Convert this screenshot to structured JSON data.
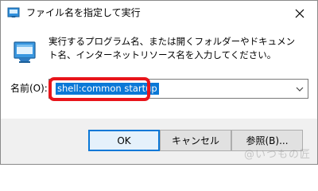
{
  "window": {
    "title": "ファイル名を指定して実行",
    "close_icon": "close-icon"
  },
  "body": {
    "description": "実行するプログラム名、または開くフォルダーやドキュメント名、インターネットリソース名を入力してください。",
    "open_label": "名前(O):",
    "combo_value": "shell:common startup"
  },
  "buttons": {
    "ok": "OK",
    "cancel": "キャンセル",
    "browse": "参照(B)..."
  },
  "watermark": "@いつもの匠",
  "colors": {
    "highlight": "#e8151b",
    "selection": "#0a78d7",
    "footer_bg": "#f0f0f0"
  }
}
